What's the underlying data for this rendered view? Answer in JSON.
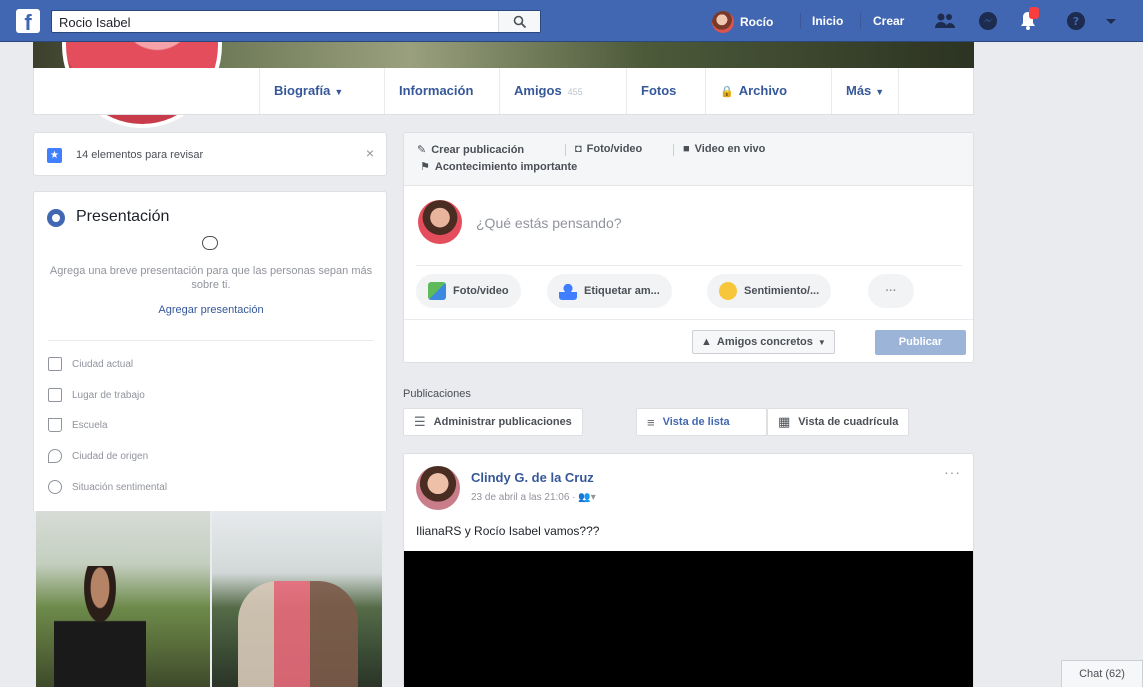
{
  "topbar": {
    "search_value": "Rocio Isabel",
    "user_name": "Rocío",
    "nav_home": "Inicio",
    "nav_create": "Crear"
  },
  "profile_tabs": [
    {
      "label": "Biografía"
    },
    {
      "label": "Información"
    },
    {
      "label": "Amigos",
      "count": "455"
    },
    {
      "label": "Fotos"
    },
    {
      "label": "Archivo"
    },
    {
      "label": "Más"
    }
  ],
  "review": {
    "label": "14 elementos para revisar",
    "close": "×"
  },
  "intro": {
    "title": "Presentación",
    "description": "Agrega una breve presentación para que las personas sepan más sobre ti.",
    "link": "Agregar presentación",
    "items": [
      "Ciudad actual",
      "Lugar de trabajo",
      "Escuela",
      "Ciudad de origen",
      "Situación sentimental"
    ]
  },
  "composer": {
    "opt_create": "Crear publicación",
    "opt_photo": "Foto/video",
    "opt_live": "Video en vivo",
    "opt_event": "Acontecimiento importante",
    "placeholder": "¿Qué estás pensando?",
    "pill_photo": "Foto/video",
    "pill_tag": "Etiquetar am...",
    "pill_feeling": "Sentimiento/...",
    "pill_more": "···",
    "audience": "Amigos concretos",
    "publish": "Publicar"
  },
  "publications": {
    "label": "Publicaciones",
    "manage": "Administrar publicaciones",
    "list_view": "Vista de lista",
    "grid_view": "Vista de cuadrícula"
  },
  "post": {
    "author": "Clindy G. de la Cruz",
    "meta": "23 de abril a las 21:06 ·",
    "text": "IlianaRS y Rocío Isabel vamos???",
    "more": "···"
  },
  "chat": {
    "label": "Chat (62)"
  },
  "colors": {
    "brand": "#4267b2",
    "link": "#365899",
    "publish_disabled": "#9cb4d8"
  }
}
